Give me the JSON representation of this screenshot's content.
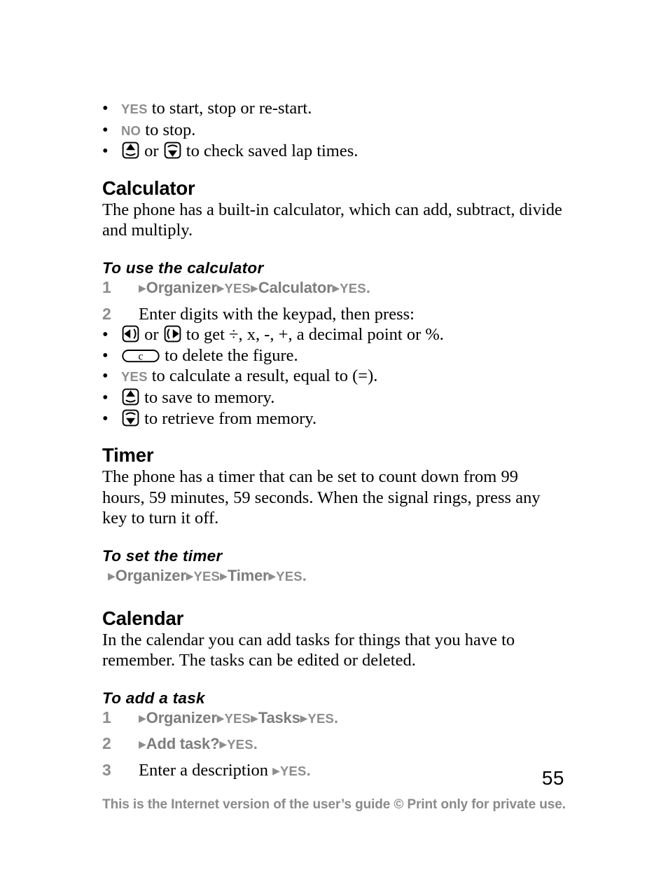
{
  "document": {
    "page_number": "55",
    "footer_note": "This is the Internet version of the user’s guide © Print only for private use.",
    "colors": {
      "text": "#000000",
      "menu_name_grey": "#7d7d7d",
      "key_word_grey": "#8d8d8d",
      "footer_grey": "#8a8a8a",
      "page_background": "#ffffff"
    }
  },
  "stopwatch_bullets": [
    {
      "icon": null,
      "key": "YES",
      "text": " to start, stop or re-start."
    },
    {
      "icon": null,
      "key": "NO",
      "text": " to stop."
    },
    {
      "icon": "key-up-icon",
      "middle": " or ",
      "icon2": "key-down-icon",
      "text": " to check saved lap times."
    }
  ],
  "sections": [
    {
      "id": "calculator",
      "title": "Calculator",
      "body": "The phone has a built-in calculator, which can add, subtract, divide and multiply.",
      "procedure": {
        "title": "To use the calculator",
        "steps": [
          {
            "number": "1",
            "type": "path",
            "path": [
              "▶",
              "Organizer",
              "▶",
              "YES",
              "▶",
              "Calculator",
              "▶",
              "YES",
              "."
            ]
          },
          {
            "number": "2",
            "type": "text",
            "text": "Enter digits with the keypad, then press:",
            "bullets": [
              {
                "icon": "key-left-icon",
                "middle": " or ",
                "icon2": "key-right-icon",
                "text": " to get ÷, x, -, +, a decimal point or %."
              },
              {
                "icon": "key-clear-icon",
                "text": " to delete the figure."
              },
              {
                "key": "YES",
                "text": " to calculate a result, equal to (=)."
              },
              {
                "icon": "key-up-icon",
                "text": " to save to memory."
              },
              {
                "icon": "key-down-icon",
                "text": " to retrieve from memory."
              }
            ]
          }
        ]
      }
    },
    {
      "id": "timer",
      "title": "Timer",
      "body": "The phone has a timer that can be set to count down from 99 hours, 59 minutes, 59 seconds. When the signal rings, press any key to turn it off.",
      "procedure": {
        "title": "To set the timer",
        "steps": [
          {
            "number": "",
            "type": "path",
            "path": [
              "▶",
              "Organizer",
              "▶",
              "YES",
              "▶",
              "Timer",
              "▶",
              "YES",
              "."
            ]
          }
        ]
      }
    },
    {
      "id": "calendar",
      "title": "Calendar",
      "body": "In the calendar you can add tasks for things that you have to remember. The tasks can be edited or deleted.",
      "procedure": {
        "title": "To add a task",
        "steps": [
          {
            "number": "1",
            "type": "path",
            "path": [
              "▶",
              "Organizer",
              "▶",
              "YES",
              "▶",
              "Tasks",
              "▶",
              "YES",
              "."
            ]
          },
          {
            "number": "2",
            "type": "path",
            "path": [
              "▶",
              "Add task?",
              "▶",
              "YES",
              "."
            ]
          },
          {
            "number": "3",
            "type": "mixed",
            "text": "Enter a description ",
            "path": [
              "▶",
              "YES",
              "."
            ]
          }
        ]
      }
    }
  ],
  "labels": {
    "bullet_mark": "•",
    "arrow": "▶",
    "or": " or ",
    "period": ".",
    "clear_key_letter": "c"
  },
  "icons": {
    "key_up": "key-up-icon",
    "key_down": "key-down-icon",
    "key_left": "key-left-icon",
    "key_right": "key-right-icon",
    "key_clear": "key-clear-icon"
  }
}
